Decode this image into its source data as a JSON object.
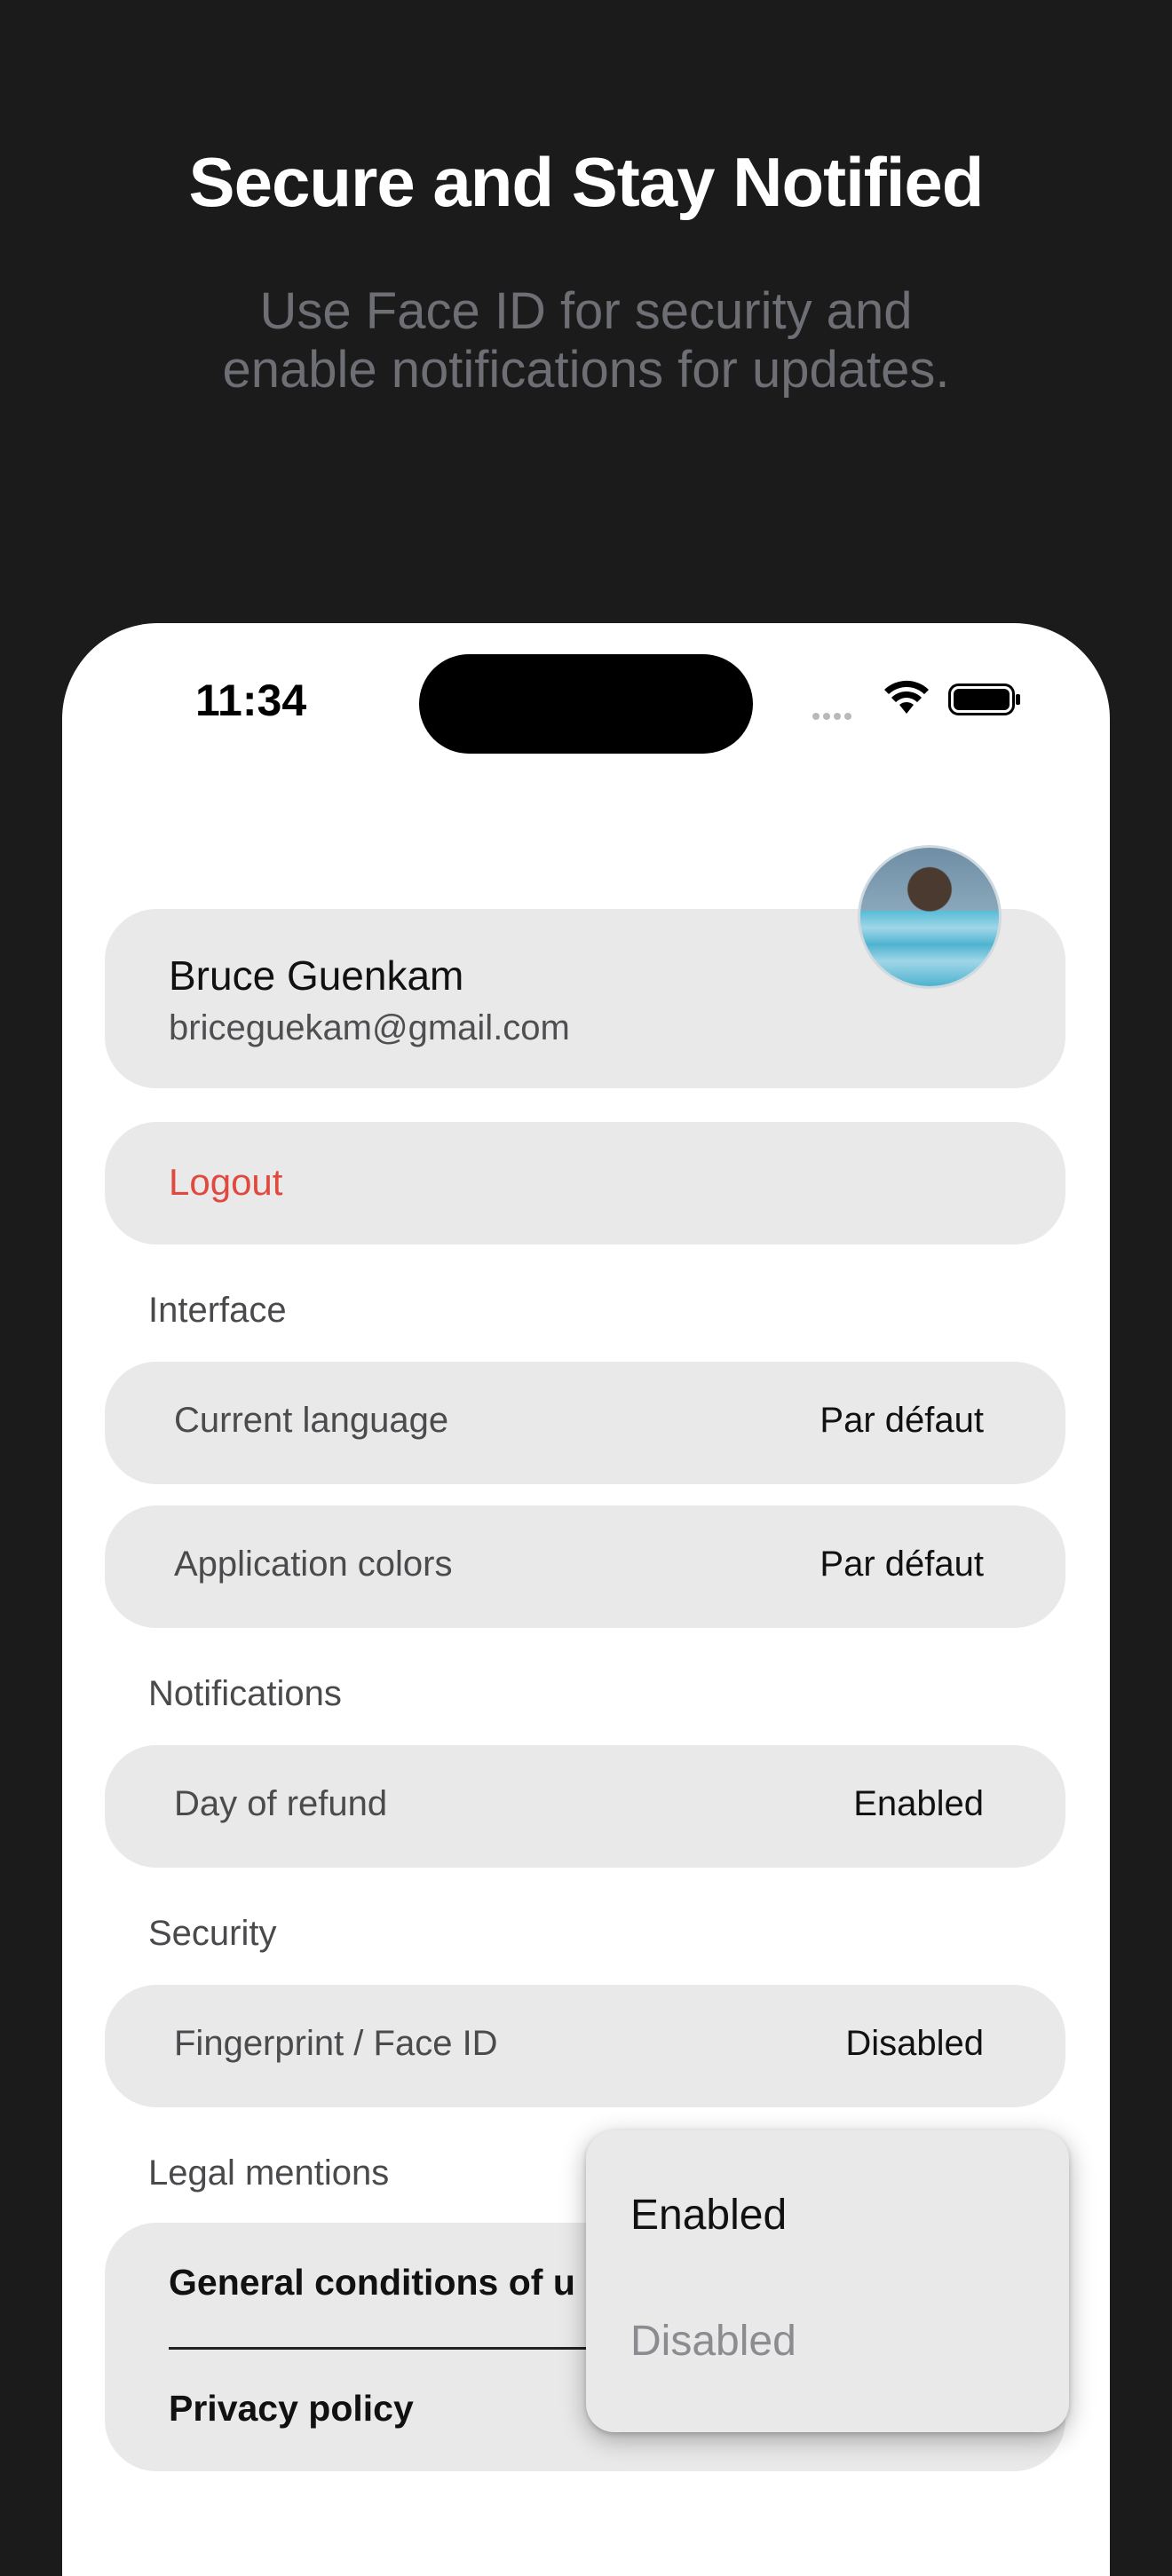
{
  "hero": {
    "title": "Secure and Stay Notified",
    "subtitle": "Use Face ID for security and enable notifications for updates."
  },
  "status_bar": {
    "time": "11:34",
    "icons": [
      "cellular-signal-icon",
      "wifi-icon",
      "battery-icon"
    ]
  },
  "profile": {
    "name": "Bruce Guenkam",
    "email": "briceguekam@gmail.com",
    "avatar": "avatar-photo"
  },
  "logout": {
    "label": "Logout",
    "color": "#e0493e"
  },
  "sections": {
    "interface": {
      "label": "Interface",
      "rows": [
        {
          "label": "Current language",
          "value": "Par défaut"
        },
        {
          "label": "Application colors",
          "value": "Par défaut"
        }
      ]
    },
    "notifications": {
      "label": "Notifications",
      "rows": [
        {
          "label": "Day of refund",
          "value": "Enabled"
        }
      ]
    },
    "security": {
      "label": "Security",
      "rows": [
        {
          "label": "Fingerprint / Face ID",
          "value": "Disabled"
        }
      ]
    },
    "legal": {
      "label": "Legal mentions",
      "items": [
        "General conditions of u",
        "Privacy policy"
      ]
    }
  },
  "popup_menu": {
    "options": [
      {
        "label": "Enabled",
        "state": "selected"
      },
      {
        "label": "Disabled",
        "state": "unselected"
      }
    ]
  },
  "colors": {
    "background": "#1b1b1c",
    "card": "#e9e9e9",
    "danger": "#e0493e"
  }
}
